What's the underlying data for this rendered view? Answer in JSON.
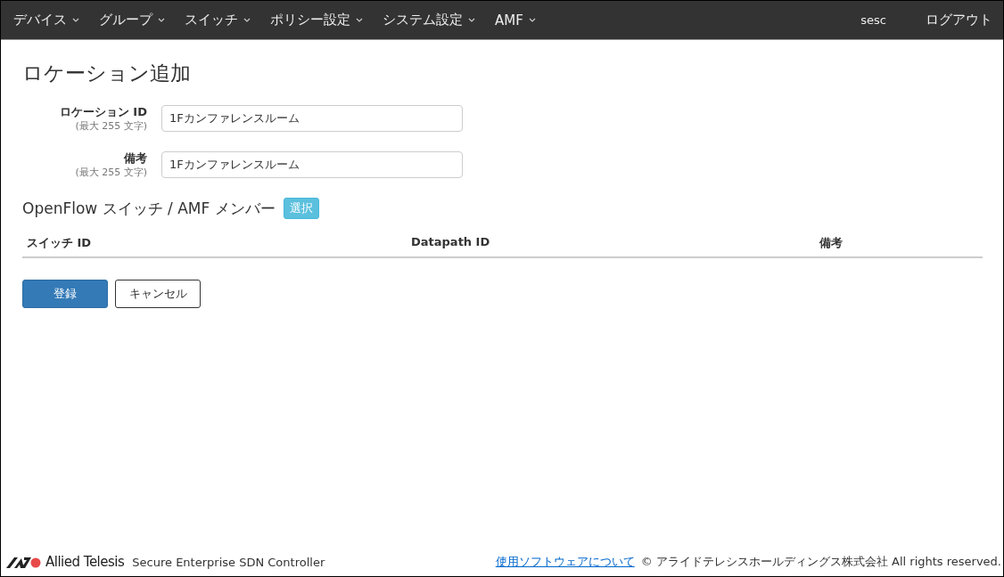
{
  "nav": {
    "menus": [
      {
        "label": "デバイス"
      },
      {
        "label": "グループ"
      },
      {
        "label": "スイッチ"
      },
      {
        "label": "ポリシー設定"
      },
      {
        "label": "システム設定"
      },
      {
        "label": "AMF"
      }
    ],
    "user": "sesc",
    "logout": "ログアウト"
  },
  "page_title": "ロケーション追加",
  "fields": [
    {
      "label": "ロケーション ID",
      "hint": "(最大 255 文字)",
      "value": "1Fカンファレンスルーム"
    },
    {
      "label": "備考",
      "hint": "(最大 255 文字)",
      "value": "1Fカンファレンスルーム"
    }
  ],
  "members": {
    "heading": "OpenFlow スイッチ / AMF メンバー",
    "select_button": "選択",
    "columns": [
      "スイッチ ID",
      "Datapath ID",
      "備考"
    ]
  },
  "buttons": [
    {
      "label": "登録",
      "kind": "primary"
    },
    {
      "label": "キャンセル",
      "kind": "default"
    }
  ],
  "footer": {
    "brand": "Allied Telesis",
    "product": "Secure Enterprise SDN Controller",
    "link": "使用ソフトウェアについて",
    "copyright": "© アライドテレシスホールディングス株式会社 All rights reserved."
  }
}
